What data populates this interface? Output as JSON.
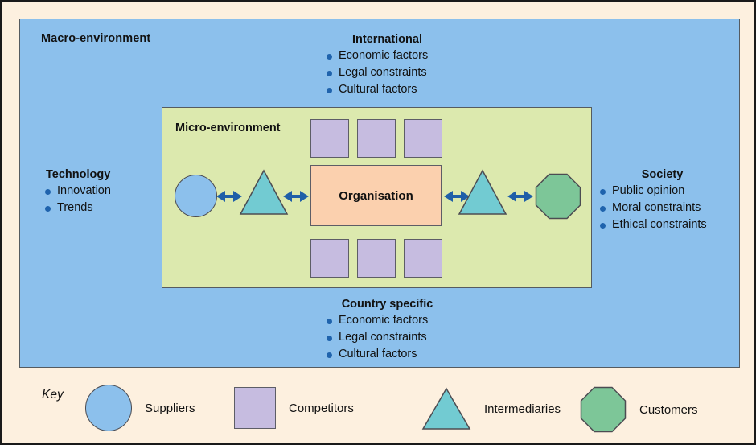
{
  "diagram": {
    "macro": {
      "label": "Macro-environment"
    },
    "micro": {
      "label": "Micro-environment"
    },
    "organisation": {
      "label": "Organisation"
    },
    "factor_groups": [
      {
        "id": "international",
        "title": "International",
        "items": [
          "Economic factors",
          "Legal constraints",
          "Cultural factors"
        ]
      },
      {
        "id": "technology",
        "title": "Technology",
        "items": [
          "Innovation",
          "Trends"
        ]
      },
      {
        "id": "society",
        "title": "Society",
        "items": [
          "Public opinion",
          "Moral constraints",
          "Ethical constraints"
        ]
      },
      {
        "id": "country-specific",
        "title": "Country specific",
        "items": [
          "Economic factors",
          "Legal constraints",
          "Cultural factors"
        ]
      }
    ]
  },
  "key": {
    "label": "Key",
    "items": [
      {
        "shape": "circle-icon",
        "label": "Suppliers"
      },
      {
        "shape": "square-icon",
        "label": "Competitors"
      },
      {
        "shape": "triangle-icon",
        "label": "Intermediaries"
      },
      {
        "shape": "octagon-icon",
        "label": "Customers"
      }
    ]
  },
  "colors": {
    "page_background": "#fdf0df",
    "macro_environment": "#8cc0ec",
    "micro_environment": "#dce9ae",
    "organisation": "#fbd0ae",
    "supplier_circle": "#8cc0ec",
    "competitor_square": "#c6bce0",
    "intermediary_triangle": "#72cbd2",
    "customer_octagon": "#7dc698",
    "arrow": "#1f5fa8",
    "bullet": "#1f63ad",
    "outline": "#555b60"
  }
}
